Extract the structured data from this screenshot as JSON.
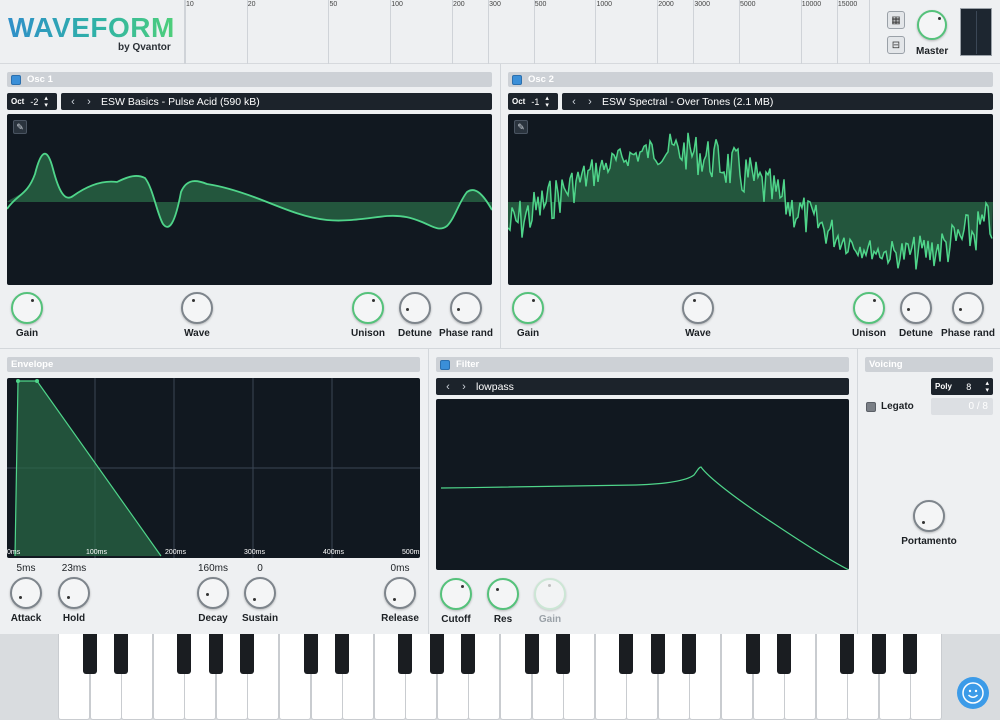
{
  "header": {
    "logo_title": "WAVEFORM",
    "logo_sub": "by Qvantor",
    "freq_labels": [
      "10",
      "20",
      "50",
      "100",
      "200",
      "300",
      "500",
      "1000",
      "2000",
      "3000",
      "5000",
      "10000",
      "15000"
    ],
    "master_label": "Master",
    "icons": [
      "grid-icon",
      "save-icon"
    ]
  },
  "osc1": {
    "title": "Osc 1",
    "oct_label": "Oct",
    "oct_value": "-2",
    "preset": "ESW Basics - Pulse Acid (590 kB)",
    "knobs": [
      "Gain",
      "Wave",
      "Unison",
      "Detune",
      "Phase rand"
    ]
  },
  "osc2": {
    "title": "Osc 2",
    "oct_label": "Oct",
    "oct_value": "-1",
    "preset": "ESW Spectral - Over Tones (2.1 MB)",
    "knobs": [
      "Gain",
      "Wave",
      "Unison",
      "Detune",
      "Phase rand"
    ]
  },
  "envelope": {
    "title": "Envelope",
    "time_labels": [
      "0ms",
      "100ms",
      "200ms",
      "300ms",
      "400ms",
      "500ms"
    ],
    "attack": {
      "label": "Attack",
      "value": "5ms"
    },
    "hold": {
      "label": "Hold",
      "value": "23ms"
    },
    "decay": {
      "label": "Decay",
      "value": "160ms"
    },
    "sustain": {
      "label": "Sustain",
      "value": "0"
    },
    "release": {
      "label": "Release",
      "value": "0ms"
    }
  },
  "filter": {
    "title": "Filter",
    "type": "lowpass",
    "knobs": [
      "Cutoff",
      "Res",
      "Gain"
    ]
  },
  "voicing": {
    "title": "Voicing",
    "mode": "Poly",
    "voices": "8",
    "legato_label": "Legato",
    "voice_count": "0 / 8",
    "portamento_label": "Portamento"
  },
  "colors": {
    "accent_green": "#4fd58a",
    "dark_panel": "#111820",
    "checkbox_blue": "#3a8fd8"
  }
}
